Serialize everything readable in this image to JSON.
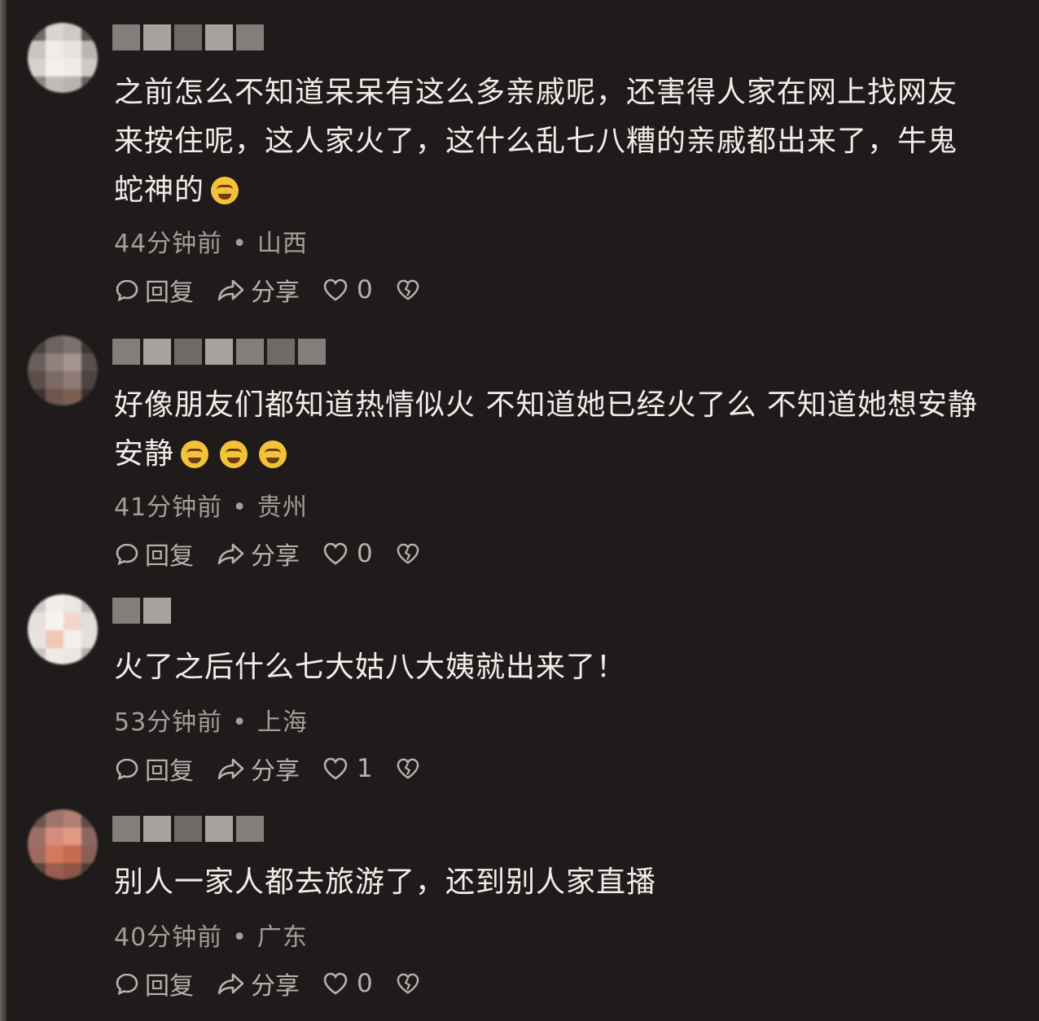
{
  "comments": [
    {
      "text": "之前怎么不知道呆呆有这么多亲戚呢，还害得人家在网上找网友\n来按住呢，这人家火了，这什么乱七八糟的亲戚都出来了，牛鬼\n蛇神的",
      "emojis": [
        "crying-face-emoji"
      ],
      "time": "44分钟前",
      "location": "山西",
      "reply_label": "回复",
      "share_label": "分享",
      "likes": "0"
    },
    {
      "text": "好像朋友们都知道热情似火 不知道她已经火了么 不知道她想安静\n安静",
      "emojis": [
        "tears-of-joy-emoji",
        "tears-of-joy-emoji",
        "tears-of-joy-emoji"
      ],
      "time": "41分钟前",
      "location": "贵州",
      "reply_label": "回复",
      "share_label": "分享",
      "likes": "0"
    },
    {
      "text": "火了之后什么七大姑八大姨就出来了！",
      "emojis": [],
      "time": "53分钟前",
      "location": "上海",
      "reply_label": "回复",
      "share_label": "分享",
      "likes": "1"
    },
    {
      "text": "别人一家人都去旅游了，还到别人家直播",
      "emojis": [],
      "time": "40分钟前",
      "location": "广东",
      "reply_label": "回复",
      "share_label": "分享",
      "likes": "0"
    }
  ],
  "colors": {
    "background": "#1e1b1a",
    "text": "#f1edeb",
    "meta": "#a49e9b"
  },
  "icons": [
    "comment-bubble-icon",
    "share-arrow-icon",
    "heart-icon",
    "broken-heart-icon"
  ]
}
